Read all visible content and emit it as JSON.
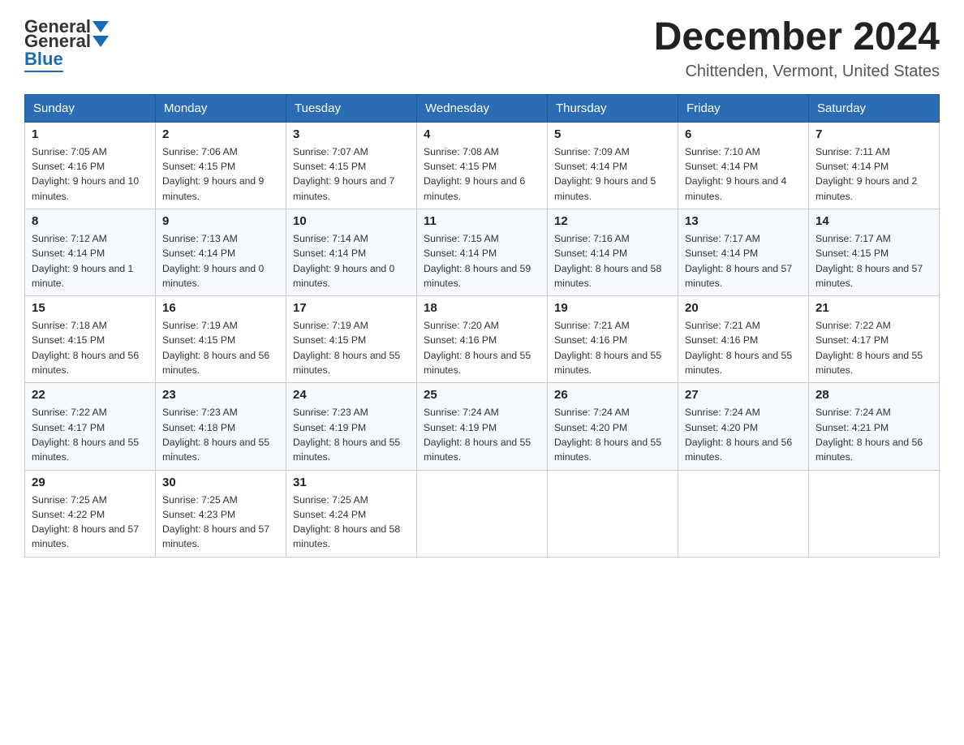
{
  "header": {
    "logo": {
      "general": "General",
      "blue": "Blue"
    },
    "title": "December 2024",
    "subtitle": "Chittenden, Vermont, United States"
  },
  "weekdays": [
    "Sunday",
    "Monday",
    "Tuesday",
    "Wednesday",
    "Thursday",
    "Friday",
    "Saturday"
  ],
  "weeks": [
    [
      {
        "day": "1",
        "sunrise": "7:05 AM",
        "sunset": "4:16 PM",
        "daylight": "9 hours and 10 minutes."
      },
      {
        "day": "2",
        "sunrise": "7:06 AM",
        "sunset": "4:15 PM",
        "daylight": "9 hours and 9 minutes."
      },
      {
        "day": "3",
        "sunrise": "7:07 AM",
        "sunset": "4:15 PM",
        "daylight": "9 hours and 7 minutes."
      },
      {
        "day": "4",
        "sunrise": "7:08 AM",
        "sunset": "4:15 PM",
        "daylight": "9 hours and 6 minutes."
      },
      {
        "day": "5",
        "sunrise": "7:09 AM",
        "sunset": "4:14 PM",
        "daylight": "9 hours and 5 minutes."
      },
      {
        "day": "6",
        "sunrise": "7:10 AM",
        "sunset": "4:14 PM",
        "daylight": "9 hours and 4 minutes."
      },
      {
        "day": "7",
        "sunrise": "7:11 AM",
        "sunset": "4:14 PM",
        "daylight": "9 hours and 2 minutes."
      }
    ],
    [
      {
        "day": "8",
        "sunrise": "7:12 AM",
        "sunset": "4:14 PM",
        "daylight": "9 hours and 1 minute."
      },
      {
        "day": "9",
        "sunrise": "7:13 AM",
        "sunset": "4:14 PM",
        "daylight": "9 hours and 0 minutes."
      },
      {
        "day": "10",
        "sunrise": "7:14 AM",
        "sunset": "4:14 PM",
        "daylight": "9 hours and 0 minutes."
      },
      {
        "day": "11",
        "sunrise": "7:15 AM",
        "sunset": "4:14 PM",
        "daylight": "8 hours and 59 minutes."
      },
      {
        "day": "12",
        "sunrise": "7:16 AM",
        "sunset": "4:14 PM",
        "daylight": "8 hours and 58 minutes."
      },
      {
        "day": "13",
        "sunrise": "7:17 AM",
        "sunset": "4:14 PM",
        "daylight": "8 hours and 57 minutes."
      },
      {
        "day": "14",
        "sunrise": "7:17 AM",
        "sunset": "4:15 PM",
        "daylight": "8 hours and 57 minutes."
      }
    ],
    [
      {
        "day": "15",
        "sunrise": "7:18 AM",
        "sunset": "4:15 PM",
        "daylight": "8 hours and 56 minutes."
      },
      {
        "day": "16",
        "sunrise": "7:19 AM",
        "sunset": "4:15 PM",
        "daylight": "8 hours and 56 minutes."
      },
      {
        "day": "17",
        "sunrise": "7:19 AM",
        "sunset": "4:15 PM",
        "daylight": "8 hours and 55 minutes."
      },
      {
        "day": "18",
        "sunrise": "7:20 AM",
        "sunset": "4:16 PM",
        "daylight": "8 hours and 55 minutes."
      },
      {
        "day": "19",
        "sunrise": "7:21 AM",
        "sunset": "4:16 PM",
        "daylight": "8 hours and 55 minutes."
      },
      {
        "day": "20",
        "sunrise": "7:21 AM",
        "sunset": "4:16 PM",
        "daylight": "8 hours and 55 minutes."
      },
      {
        "day": "21",
        "sunrise": "7:22 AM",
        "sunset": "4:17 PM",
        "daylight": "8 hours and 55 minutes."
      }
    ],
    [
      {
        "day": "22",
        "sunrise": "7:22 AM",
        "sunset": "4:17 PM",
        "daylight": "8 hours and 55 minutes."
      },
      {
        "day": "23",
        "sunrise": "7:23 AM",
        "sunset": "4:18 PM",
        "daylight": "8 hours and 55 minutes."
      },
      {
        "day": "24",
        "sunrise": "7:23 AM",
        "sunset": "4:19 PM",
        "daylight": "8 hours and 55 minutes."
      },
      {
        "day": "25",
        "sunrise": "7:24 AM",
        "sunset": "4:19 PM",
        "daylight": "8 hours and 55 minutes."
      },
      {
        "day": "26",
        "sunrise": "7:24 AM",
        "sunset": "4:20 PM",
        "daylight": "8 hours and 55 minutes."
      },
      {
        "day": "27",
        "sunrise": "7:24 AM",
        "sunset": "4:20 PM",
        "daylight": "8 hours and 56 minutes."
      },
      {
        "day": "28",
        "sunrise": "7:24 AM",
        "sunset": "4:21 PM",
        "daylight": "8 hours and 56 minutes."
      }
    ],
    [
      {
        "day": "29",
        "sunrise": "7:25 AM",
        "sunset": "4:22 PM",
        "daylight": "8 hours and 57 minutes."
      },
      {
        "day": "30",
        "sunrise": "7:25 AM",
        "sunset": "4:23 PM",
        "daylight": "8 hours and 57 minutes."
      },
      {
        "day": "31",
        "sunrise": "7:25 AM",
        "sunset": "4:24 PM",
        "daylight": "8 hours and 58 minutes."
      },
      null,
      null,
      null,
      null
    ]
  ],
  "labels": {
    "sunrise": "Sunrise:",
    "sunset": "Sunset:",
    "daylight": "Daylight:"
  }
}
